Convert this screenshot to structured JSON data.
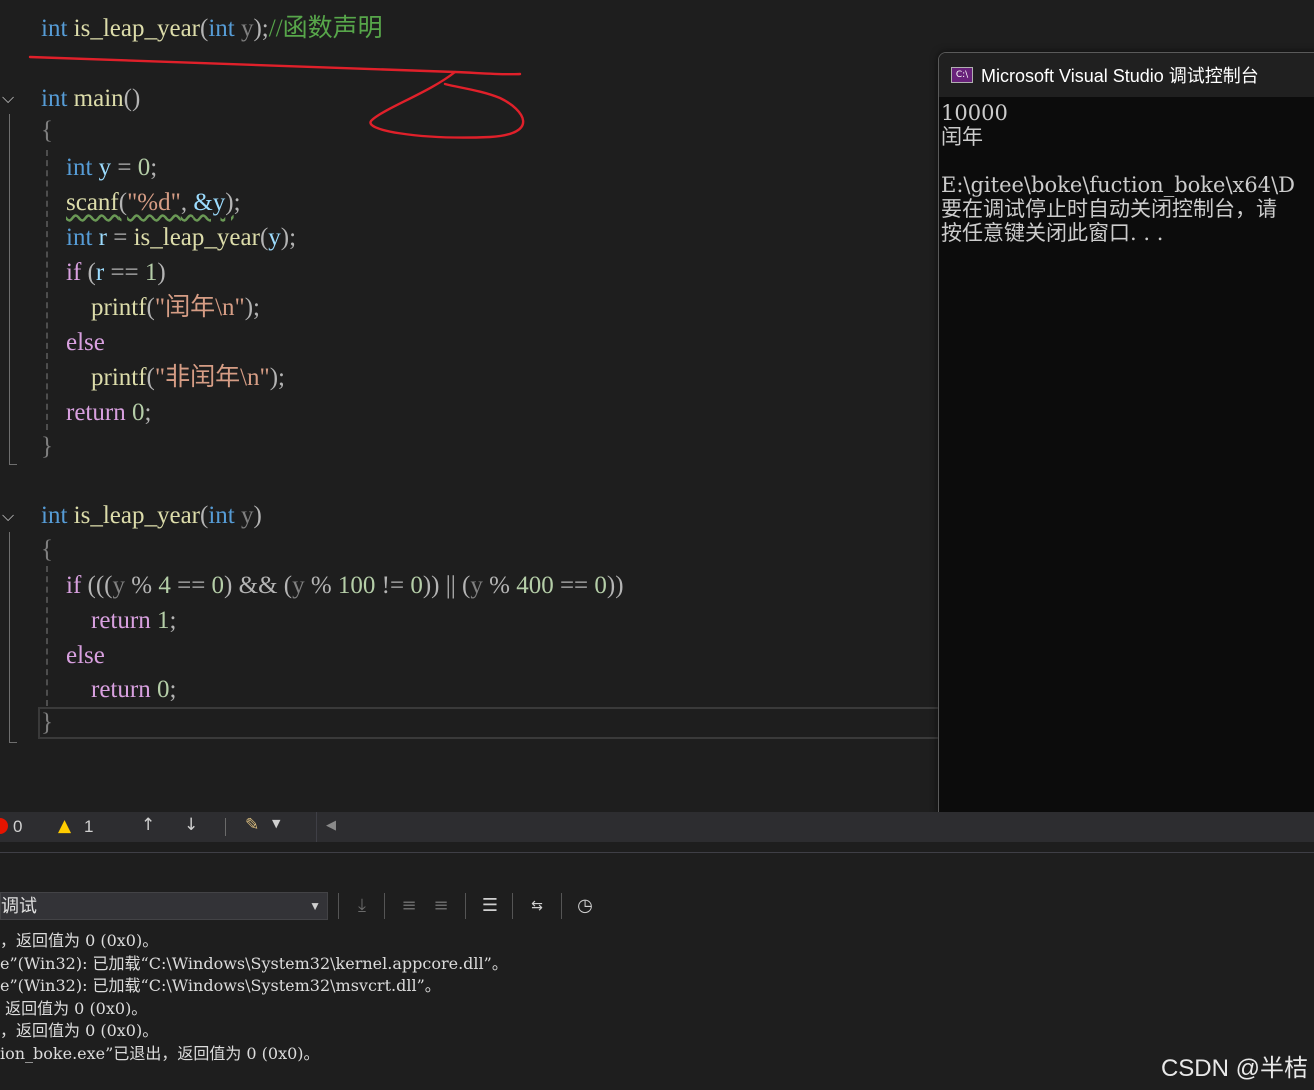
{
  "editor": {
    "lines": [
      [
        {
          "t": "int",
          "c": "kw"
        },
        {
          "t": " is_leap_year",
          "c": "fn"
        },
        {
          "t": "(",
          "c": "pn"
        },
        {
          "t": "int",
          "c": "kw"
        },
        {
          "t": " y",
          "c": "gr"
        },
        {
          "t": ");",
          "c": "pn"
        },
        {
          "t": "//函数声明",
          "c": "cmt"
        }
      ],
      [
        {
          "t": "int",
          "c": "kw"
        },
        {
          "t": " main",
          "c": "fn"
        },
        {
          "t": "()",
          "c": "pn"
        }
      ],
      [
        {
          "t": "{",
          "c": "gr"
        }
      ],
      [
        {
          "t": "    "
        },
        {
          "t": "int",
          "c": "kw"
        },
        {
          "t": " y",
          "c": "var"
        },
        {
          "t": " = ",
          "c": "pn"
        },
        {
          "t": "0",
          "c": "num"
        },
        {
          "t": ";",
          "c": "pn"
        }
      ],
      [
        {
          "t": "    "
        },
        {
          "t": "scanf",
          "c": "fn squig"
        },
        {
          "t": "(",
          "c": "pn squig"
        },
        {
          "t": "\"%d\"",
          "c": "str squig"
        },
        {
          "t": ", ",
          "c": "pn squig"
        },
        {
          "t": "&y",
          "c": "var squig"
        },
        {
          "t": ")",
          "c": "pn squig"
        },
        {
          "t": ";",
          "c": "pn"
        }
      ],
      [
        {
          "t": "    "
        },
        {
          "t": "int",
          "c": "kw"
        },
        {
          "t": " r",
          "c": "var"
        },
        {
          "t": " = ",
          "c": "pn"
        },
        {
          "t": "is_leap_year",
          "c": "fn"
        },
        {
          "t": "(",
          "c": "pn"
        },
        {
          "t": "y",
          "c": "var"
        },
        {
          "t": ");",
          "c": "pn"
        }
      ],
      [
        {
          "t": "    "
        },
        {
          "t": "if",
          "c": "kw2"
        },
        {
          "t": " (",
          "c": "pn"
        },
        {
          "t": "r",
          "c": "var"
        },
        {
          "t": " == ",
          "c": "pn"
        },
        {
          "t": "1",
          "c": "num"
        },
        {
          "t": ")",
          "c": "pn"
        }
      ],
      [
        {
          "t": "        "
        },
        {
          "t": "printf",
          "c": "fn"
        },
        {
          "t": "(",
          "c": "pn"
        },
        {
          "t": "\"闰年\\n\"",
          "c": "str"
        },
        {
          "t": ");",
          "c": "pn"
        }
      ],
      [
        {
          "t": "    "
        },
        {
          "t": "else",
          "c": "kw2"
        }
      ],
      [
        {
          "t": "        "
        },
        {
          "t": "printf",
          "c": "fn"
        },
        {
          "t": "(",
          "c": "pn"
        },
        {
          "t": "\"非闰年\\n\"",
          "c": "str"
        },
        {
          "t": ");",
          "c": "pn"
        }
      ],
      [
        {
          "t": "    "
        },
        {
          "t": "return",
          "c": "kw2"
        },
        {
          "t": " ",
          "c": "pn"
        },
        {
          "t": "0",
          "c": "num"
        },
        {
          "t": ";",
          "c": "pn"
        }
      ],
      [
        {
          "t": "}",
          "c": "gr"
        }
      ],
      [
        {
          "t": "int",
          "c": "kw"
        },
        {
          "t": " is_leap_year",
          "c": "fn"
        },
        {
          "t": "(",
          "c": "pn"
        },
        {
          "t": "int",
          "c": "kw"
        },
        {
          "t": " y",
          "c": "gr"
        },
        {
          "t": ")",
          "c": "pn"
        }
      ],
      [
        {
          "t": "{",
          "c": "gr"
        }
      ],
      [
        {
          "t": "    "
        },
        {
          "t": "if",
          "c": "kw2"
        },
        {
          "t": " (((",
          "c": "pn"
        },
        {
          "t": "y",
          "c": "gr"
        },
        {
          "t": " % ",
          "c": "pn"
        },
        {
          "t": "4",
          "c": "num"
        },
        {
          "t": " == ",
          "c": "pn"
        },
        {
          "t": "0",
          "c": "num"
        },
        {
          "t": ") && (",
          "c": "pn"
        },
        {
          "t": "y",
          "c": "gr"
        },
        {
          "t": " % ",
          "c": "pn"
        },
        {
          "t": "100",
          "c": "num"
        },
        {
          "t": " != ",
          "c": "pn"
        },
        {
          "t": "0",
          "c": "num"
        },
        {
          "t": ")) || (",
          "c": "pn"
        },
        {
          "t": "y",
          "c": "gr"
        },
        {
          "t": " % ",
          "c": "pn"
        },
        {
          "t": "400",
          "c": "num"
        },
        {
          "t": " == ",
          "c": "pn"
        },
        {
          "t": "0",
          "c": "num"
        },
        {
          "t": "))",
          "c": "pn"
        }
      ],
      [
        {
          "t": "        "
        },
        {
          "t": "return",
          "c": "kw2"
        },
        {
          "t": " ",
          "c": "pn"
        },
        {
          "t": "1",
          "c": "num"
        },
        {
          "t": ";",
          "c": "pn"
        }
      ],
      [
        {
          "t": "    "
        },
        {
          "t": "else",
          "c": "kw2"
        }
      ],
      [
        {
          "t": "        "
        },
        {
          "t": "return",
          "c": "kw2"
        },
        {
          "t": " ",
          "c": "pn"
        },
        {
          "t": "0",
          "c": "num"
        },
        {
          "t": ";",
          "c": "pn"
        }
      ],
      [
        {
          "t": "}",
          "c": "gr"
        }
      ]
    ]
  },
  "console": {
    "title": "Microsoft Visual Studio 调试控制台",
    "icon_label": "C:\\",
    "output": "10000\n闰年\n\nE:\\gitee\\boke\\fuction_boke\\x64\\D\n要在调试停止时自动关闭控制台，请\n按任意键关闭此窗口. . ."
  },
  "status": {
    "errors": "0",
    "warnings": "1"
  },
  "output_pane": {
    "source": "调试",
    "lines": [
      "，返回值为 0 (0x0)。",
      "e”(Win32): 已加载“C:\\Windows\\System32\\kernel.appcore.dll”。",
      "e”(Win32): 已加载“C:\\Windows\\System32\\msvcrt.dll”。",
      " 返回值为 0 (0x0)。",
      "，返回值为 0 (0x0)。",
      "ion_boke.exe”已退出，返回值为 0 (0x0)。"
    ]
  },
  "watermark": "CSDN @半桔",
  "colors": {
    "annotation": "#e0202a",
    "editor_bg": "#1e1e1e",
    "console_bg": "#0c0c0c"
  }
}
